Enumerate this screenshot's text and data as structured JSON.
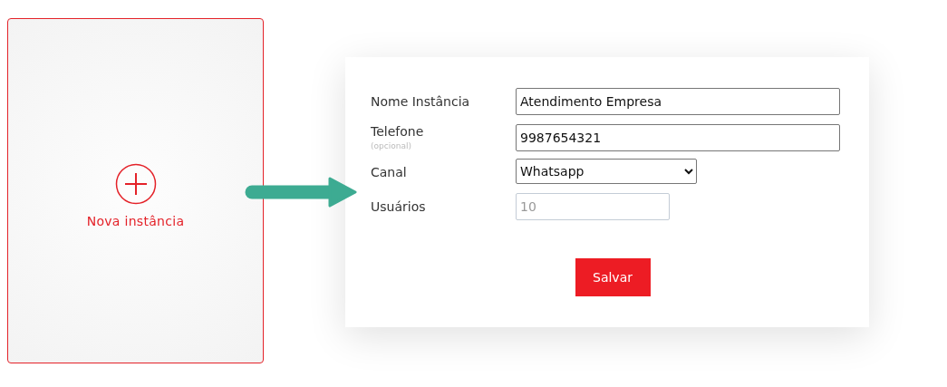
{
  "new_card": {
    "label": "Nova instância"
  },
  "form": {
    "fields": [
      {
        "kind": "text",
        "label": "Nome Instância",
        "value": "Atendimento Empresa",
        "disabled": false
      },
      {
        "kind": "text",
        "label": "Telefone",
        "hint": "(opcional)",
        "value": "9987654321",
        "disabled": false
      },
      {
        "kind": "select",
        "label": "Canal",
        "value": "Whatsapp",
        "disabled": false
      },
      {
        "kind": "number",
        "label": "Usuários",
        "value": "10",
        "disabled": true
      }
    ],
    "submit": "Salvar"
  }
}
